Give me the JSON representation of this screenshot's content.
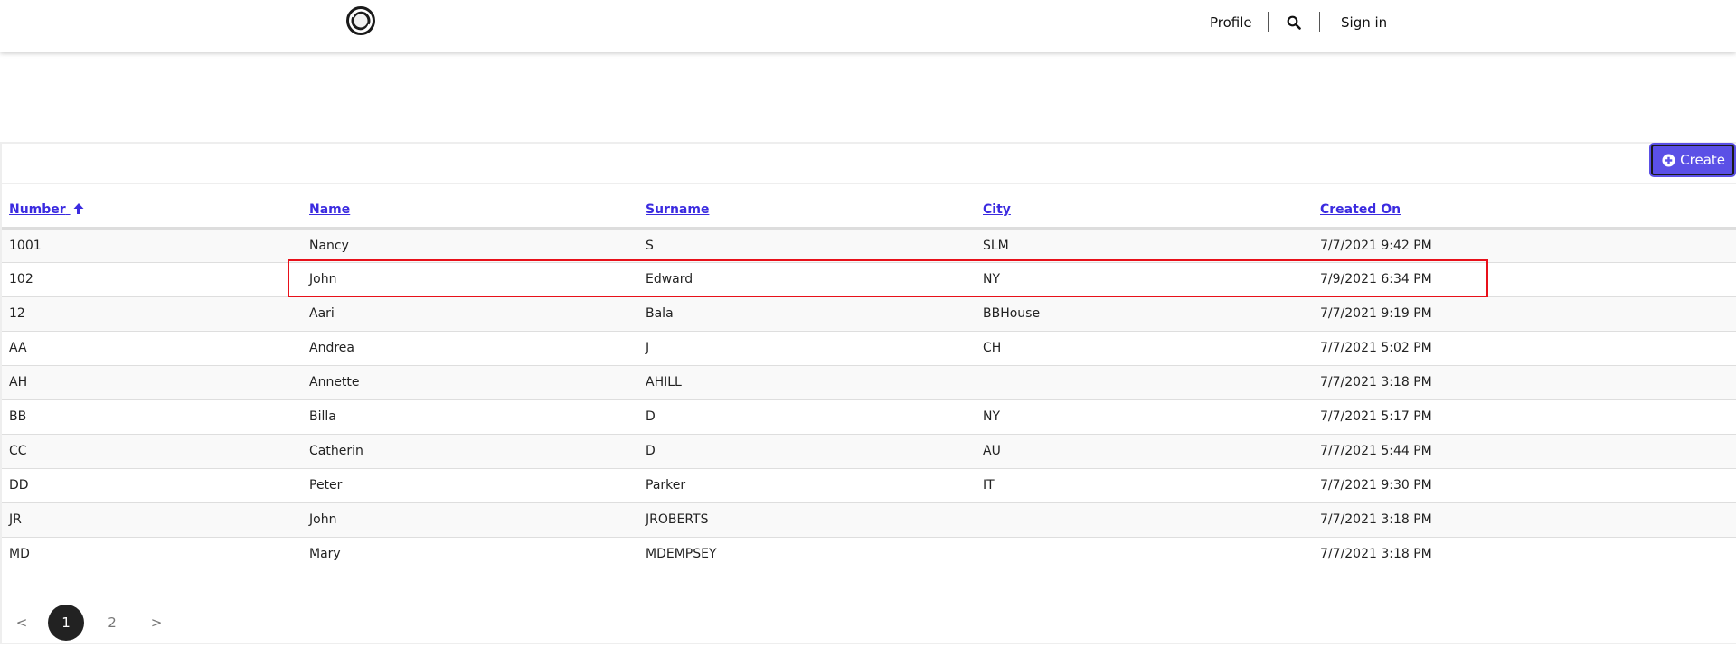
{
  "header": {
    "logo_icon": "ring-logo-icon",
    "nav": {
      "profile": "Profile",
      "search_icon": "search-icon",
      "sign_in": "Sign in"
    }
  },
  "toolbar": {
    "create_label": "Create",
    "create_icon": "plus-circle-icon",
    "accent_color": "#5b50e6"
  },
  "table": {
    "columns": [
      {
        "label": "Number",
        "sorted": "ascending",
        "sort_icon": "arrow-up-icon"
      },
      {
        "label": "Name"
      },
      {
        "label": "Surname"
      },
      {
        "label": "City"
      },
      {
        "label": "Created On"
      }
    ],
    "rows": [
      [
        "1001",
        "Nancy",
        "S",
        "SLM",
        "7/7/2021 9:42 PM"
      ],
      [
        "102",
        "John",
        "Edward",
        "NY",
        "7/9/2021 6:34 PM"
      ],
      [
        "12",
        "Aari",
        "Bala",
        "BBHouse",
        "7/7/2021 9:19 PM"
      ],
      [
        "AA",
        "Andrea",
        "J",
        "CH",
        "7/7/2021 5:02 PM"
      ],
      [
        "AH",
        "Annette",
        "AHILL",
        "",
        "7/7/2021 3:18 PM"
      ],
      [
        "BB",
        "Billa",
        "D",
        "NY",
        "7/7/2021 5:17 PM"
      ],
      [
        "CC",
        "Catherin",
        "D",
        "AU",
        "7/7/2021 5:44 PM"
      ],
      [
        "DD",
        "Peter",
        "Parker",
        "IT",
        "7/7/2021 9:30 PM"
      ],
      [
        "JR",
        "John",
        "JROBERTS",
        "",
        "7/7/2021 3:18 PM"
      ],
      [
        "MD",
        "Mary",
        "MDEMPSEY",
        "",
        "7/7/2021 3:18 PM"
      ]
    ],
    "highlighted_row_index": 1,
    "highlight_color": "#e8101a"
  },
  "pagination": {
    "prev": "<",
    "pages": [
      "1",
      "2"
    ],
    "current_page": "1",
    "next": ">"
  }
}
